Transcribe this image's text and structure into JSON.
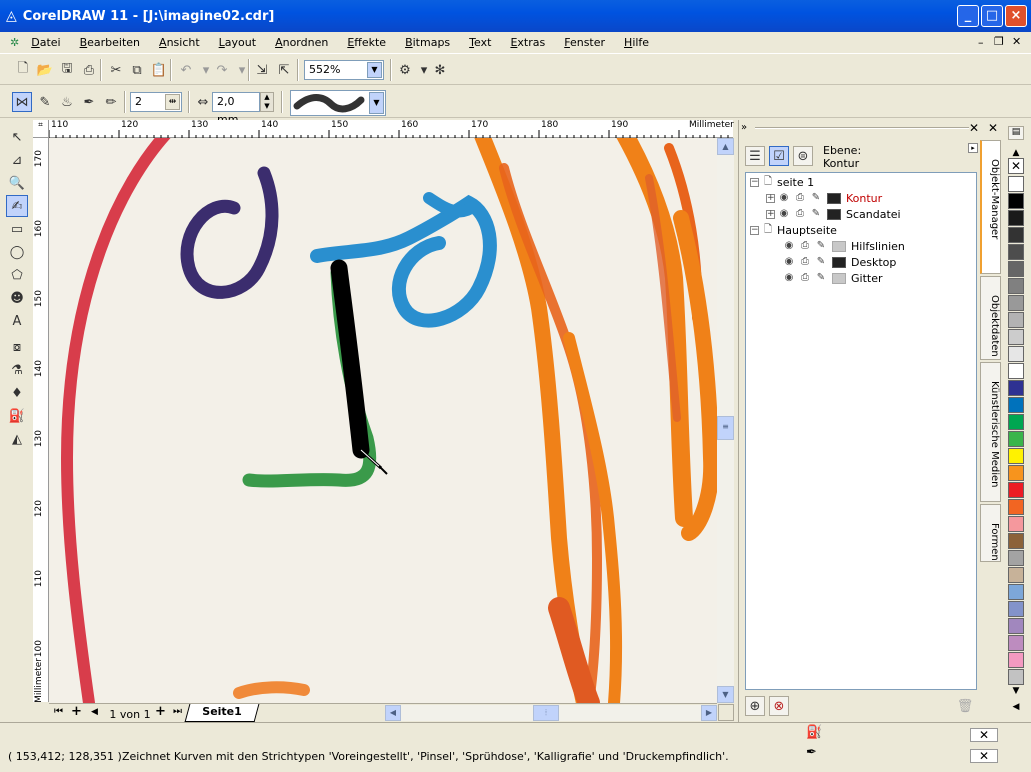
{
  "window": {
    "title": "CorelDRAW 11 - [J:\\imagine02.cdr]",
    "minimize": "_",
    "maximize": "□",
    "close": "×"
  },
  "menu": [
    "Datei",
    "Bearbeiten",
    "Ansicht",
    "Layout",
    "Anordnen",
    "Effekte",
    "Bitmaps",
    "Text",
    "Extras",
    "Fenster",
    "Hilfe"
  ],
  "standard_toolbar": {
    "zoom_level": "552%"
  },
  "property_bar": {
    "stroke_width_value": "2",
    "size_value": "2,0 mm"
  },
  "ruler": {
    "unit": "Millimeter",
    "h_ticks": [
      "110",
      "120",
      "130",
      "140",
      "150",
      "160",
      "170",
      "180",
      "190"
    ],
    "v_ticks": [
      "170",
      "160",
      "150",
      "140",
      "130",
      "120",
      "110",
      "100"
    ],
    "v_label": "Millimeter"
  },
  "page_nav": {
    "page_count": "1 von 1",
    "page_tab": "Seite1"
  },
  "docker": {
    "layer_label": "Ebene:",
    "layer_name": "Kontur",
    "tree": [
      {
        "label": "seite 1",
        "level": 0,
        "type": "page"
      },
      {
        "label": "Kontur",
        "level": 1,
        "type": "layer",
        "color": "#222222",
        "active": true
      },
      {
        "label": "Scandatei",
        "level": 1,
        "type": "layer",
        "color": "#222222"
      },
      {
        "label": "Hauptseite",
        "level": 0,
        "type": "page"
      },
      {
        "label": "Hilfslinien",
        "level": 1,
        "type": "layer",
        "color": "#c8c8c8"
      },
      {
        "label": "Desktop",
        "level": 1,
        "type": "layer",
        "color": "#222222"
      },
      {
        "label": "Gitter",
        "level": 1,
        "type": "layer",
        "color": "#c8c8c8"
      }
    ],
    "tabs": [
      "Objekt-Manager",
      "Objektdaten",
      "Künstlerische Medien",
      "Formen"
    ]
  },
  "palette": [
    "#ffffff",
    "#000000",
    "#1a1a1a",
    "#333333",
    "#4d4d4d",
    "#666666",
    "#808080",
    "#999999",
    "#b3b3b3",
    "#cccccc",
    "#e6e6e6",
    "#ffffff",
    "#2e3192",
    "#0072bc",
    "#00a651",
    "#39b54a",
    "#fff200",
    "#f7941d",
    "#ed1c24",
    "#f26522",
    "#f5989d",
    "#8c6239",
    "#a3a3a3",
    "#c7b299",
    "#7da7d9",
    "#8393ca",
    "#a187be",
    "#bd8cbf",
    "#f49ac1",
    "#c2c2c2"
  ],
  "status": {
    "coords": "( 153,412; 128,351 )",
    "message": "Zeichnet Kurven mit den Strichtypen 'Voreingestellt', 'Pinsel', 'Sprühdose', 'Kalligrafie' und 'Druckempfindlich'."
  }
}
